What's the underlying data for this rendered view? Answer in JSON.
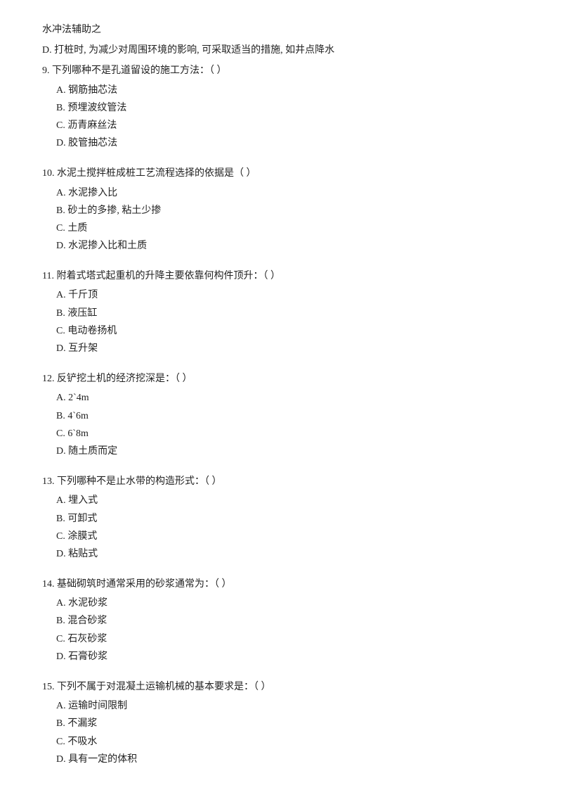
{
  "intro": {
    "line1": "水冲法辅助之",
    "line2": "D.  打桩时, 为减少对周围环境的影响, 可采取适当的措施, 如井点降水"
  },
  "questions": [
    {
      "number": "9.",
      "text": "下列哪种不是孔道留设的施工方法：（  ）",
      "options": [
        {
          "label": "A.",
          "text": "钢筋抽芯法"
        },
        {
          "label": "B.",
          "text": "预埋波纹管法"
        },
        {
          "label": "C.",
          "text": "沥青麻丝法"
        },
        {
          "label": "D.",
          "text": "胶管抽芯法"
        }
      ]
    },
    {
      "number": "10.",
      "text": "水泥土搅拌桩成桩工艺流程选择的依据是（  ）",
      "options": [
        {
          "label": "A.",
          "text": "水泥掺入比"
        },
        {
          "label": "B.",
          "text": "砂土的多掺, 粘土少掺"
        },
        {
          "label": "C.",
          "text": "土质"
        },
        {
          "label": "D.",
          "text": "水泥掺入比和土质"
        }
      ]
    },
    {
      "number": "11.",
      "text": "附着式塔式起重机的升降主要依靠何构件顶升：（  ）",
      "options": [
        {
          "label": "A.",
          "text": "千斤顶"
        },
        {
          "label": "B.",
          "text": "液压缸"
        },
        {
          "label": "C.",
          "text": "电动卷扬机"
        },
        {
          "label": "D.",
          "text": "互升架"
        }
      ]
    },
    {
      "number": "12.",
      "text": "反铲挖土机的经济挖深是：（  ）",
      "options": [
        {
          "label": "A.",
          "text": "2`4m"
        },
        {
          "label": "B.",
          "text": "4`6m"
        },
        {
          "label": "C.",
          "text": "6`8m"
        },
        {
          "label": "D.",
          "text": "随土质而定"
        }
      ]
    },
    {
      "number": "13.",
      "text": "下列哪种不是止水带的构造形式：（  ）",
      "options": [
        {
          "label": "A.",
          "text": "埋入式"
        },
        {
          "label": "B.",
          "text": "可卸式"
        },
        {
          "label": "C.",
          "text": "涂膜式"
        },
        {
          "label": "D.",
          "text": "粘贴式"
        }
      ]
    },
    {
      "number": "14.",
      "text": "基础砌筑时通常采用的砂浆通常为：（  ）",
      "options": [
        {
          "label": "A.",
          "text": "水泥砂浆"
        },
        {
          "label": "B.",
          "text": "混合砂浆"
        },
        {
          "label": "C.",
          "text": "石灰砂浆"
        },
        {
          "label": "D.",
          "text": "石膏砂浆"
        }
      ]
    },
    {
      "number": "15.",
      "text": "下列不属于对混凝土运输机械的基本要求是：（  ）",
      "options": [
        {
          "label": "A.",
          "text": "运输时间限制"
        },
        {
          "label": "B.",
          "text": "不漏浆"
        },
        {
          "label": "C.",
          "text": "不吸水"
        },
        {
          "label": "D.",
          "text": "具有一定的体积"
        }
      ]
    }
  ]
}
